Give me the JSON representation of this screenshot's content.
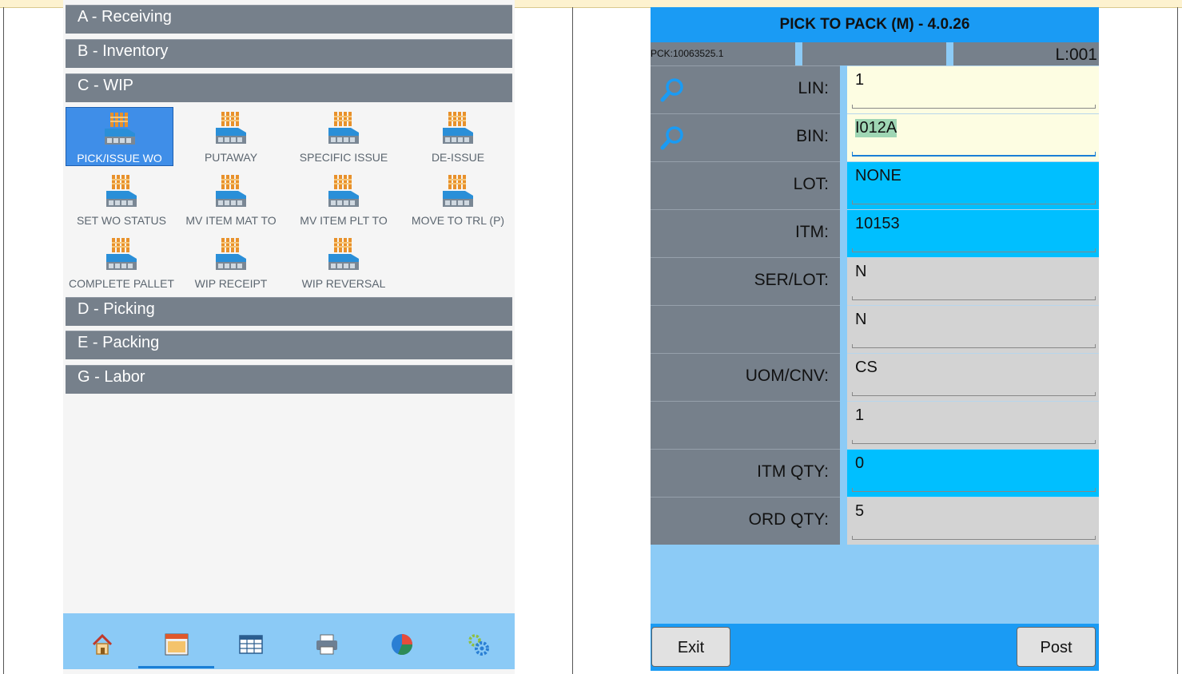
{
  "left": {
    "sections_top": [
      {
        "label": "A - Receiving"
      },
      {
        "label": "B - Inventory"
      },
      {
        "label": "C - WIP"
      }
    ],
    "wip_tiles": [
      {
        "label": "PICK/ISSUE WO",
        "selected": true
      },
      {
        "label": "PUTAWAY"
      },
      {
        "label": "SPECIFIC ISSUE"
      },
      {
        "label": "DE-ISSUE"
      },
      {
        "label": "SET WO STATUS"
      },
      {
        "label": "MV ITEM MAT TO"
      },
      {
        "label": "MV ITEM PLT TO"
      },
      {
        "label": "MOVE TO TRL (P)"
      },
      {
        "label": "COMPLETE PALLET"
      },
      {
        "label": "WIP RECEIPT"
      },
      {
        "label": "WIP REVERSAL"
      }
    ],
    "sections_bottom": [
      {
        "label": "D - Picking"
      },
      {
        "label": "E - Packing"
      },
      {
        "label": "G - Labor"
      }
    ],
    "bottom_nav": [
      "home-icon",
      "menu-icon",
      "table-icon",
      "printer-icon",
      "pie-chart-icon",
      "settings-gears-icon"
    ],
    "active_nav": "menu-icon"
  },
  "right": {
    "title": "PICK TO PACK (M) - 4.0.26",
    "pck": "PCK:10063525.1",
    "line": "L:001",
    "fields": [
      {
        "label": "LIN:",
        "value": "1",
        "style": "yellow",
        "search": true
      },
      {
        "label": "BIN:",
        "value": "I012A",
        "style": "yellow",
        "search": true,
        "focused": true,
        "highlighted": true
      },
      {
        "label": "LOT:",
        "value": "NONE",
        "style": "blue"
      },
      {
        "label": "ITM:",
        "value": "10153",
        "style": "blue"
      },
      {
        "label": "SER/LOT:",
        "value": "N",
        "style": "grey"
      },
      {
        "label": "",
        "value": "N",
        "style": "grey"
      },
      {
        "label": "UOM/CNV:",
        "value": "CS",
        "style": "grey"
      },
      {
        "label": "",
        "value": "1",
        "style": "grey"
      },
      {
        "label": "ITM QTY:",
        "value": "0",
        "style": "blue"
      },
      {
        "label": "ORD QTY:",
        "value": "5",
        "style": "grey"
      }
    ],
    "exit_label": "Exit",
    "post_label": "Post"
  },
  "colors": {
    "section_grey": "#76808b",
    "title_blue": "#1a9bf4",
    "field_blue": "#00bfff",
    "field_yellow": "#fdfde2",
    "field_grey": "#d3d3d3"
  }
}
